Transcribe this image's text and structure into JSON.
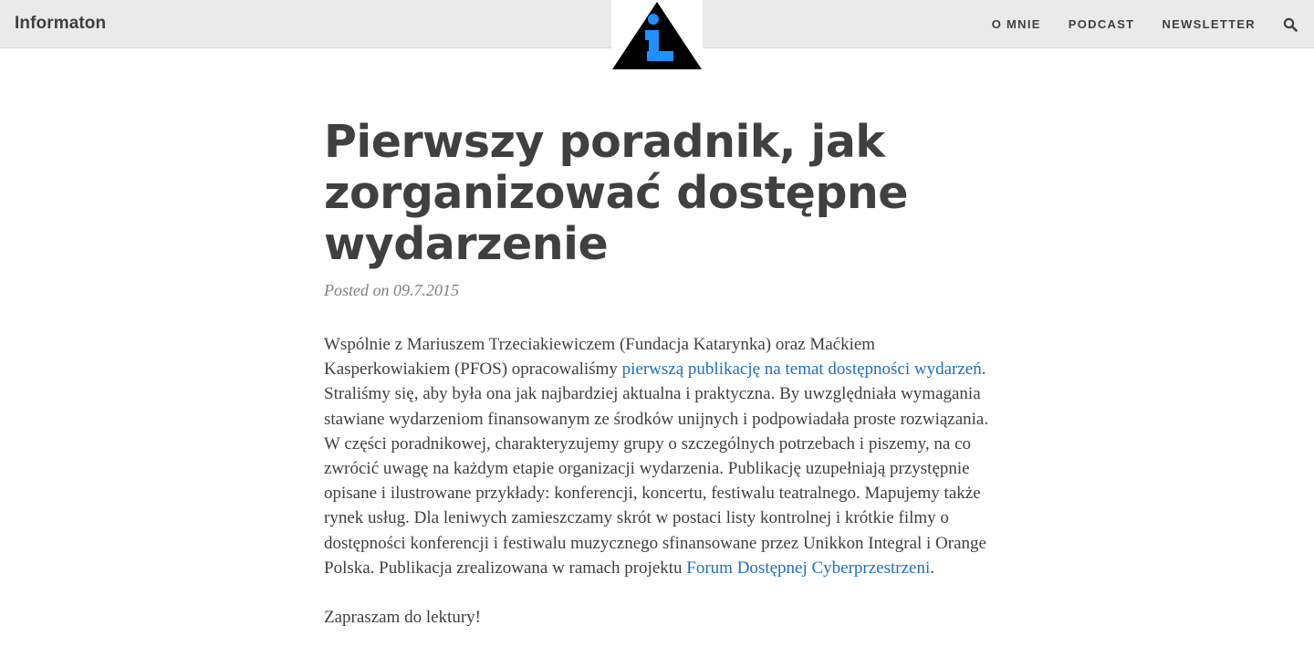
{
  "navbar": {
    "brand": "Informaton",
    "links": [
      "O MNIE",
      "PODCAST",
      "NEWSLETTER"
    ],
    "search_icon": "search-icon"
  },
  "logo": {
    "icon": "info-triangle-logo",
    "colors": {
      "triangle": "#000000",
      "glyph": "#1e90ff"
    }
  },
  "post": {
    "title": "Pierwszy poradnik, jak zorganizować dostępne wydarzenie",
    "meta": "Posted on 09.7.2015",
    "paragraph1": {
      "text1": "Wspólnie z Mariuszem Trzeciakiewiczem (Fundacja Katarynka) oraz Maćkiem Kasperkowiakiem (PFOS) opracowaliśmy ",
      "link1": "pierwszą publikację na temat dostępności wydarzeń",
      "text2": ". Straliśmy się, aby była ona jak najbardziej aktualna i praktyczna. By uwzględniała wymagania stawiane wydarzeniom finansowanym ze środków unijnych i podpowiadała proste rozwiązania. W części poradnikowej, charakteryzujemy grupy o szczególnych potrzebach i piszemy, na co zwrócić uwagę na każdym etapie organizacji wydarzenia. Publikację uzupełniają przystępnie opisane i ilustrowane przykłady: konferencji, koncertu, festiwalu teatralnego. Mapujemy także rynek usług. Dla leniwych zamieszczamy skrót w postaci listy kontrolnej i krótkie filmy o dostępności konferencji i festiwalu muzycznego sfinansowane przez Unikkon Integral i Orange Polska. Publikacja zrealizowana w ramach projektu ",
      "link2": "Forum Dostępnej Cyberprzestrzeni",
      "text3": "."
    },
    "paragraph2": "Zapraszam do lektury!"
  },
  "colors": {
    "navbar_bg": "#eaeaea",
    "text": "#404040",
    "meta": "#808080",
    "link": "#1f6fbf"
  }
}
